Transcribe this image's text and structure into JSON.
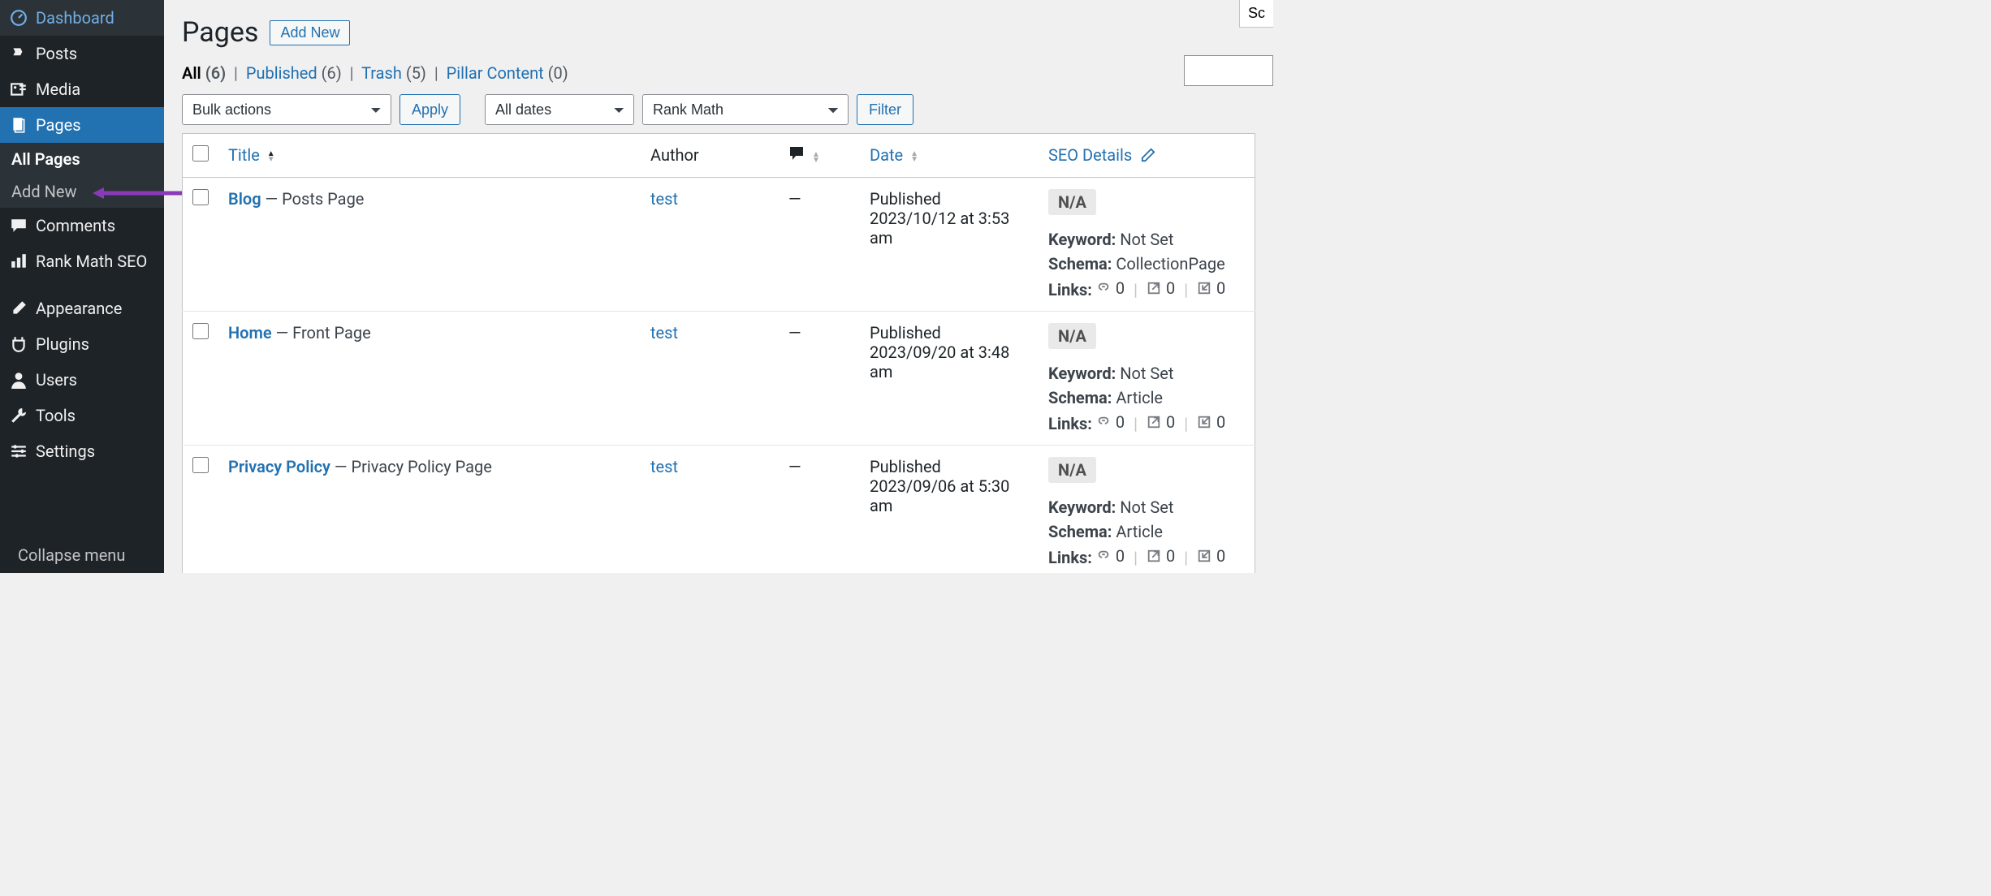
{
  "sidebar": {
    "items": [
      {
        "label": "Dashboard",
        "icon": "dashboard"
      },
      {
        "label": "Posts",
        "icon": "pin"
      },
      {
        "label": "Media",
        "icon": "media"
      },
      {
        "label": "Pages",
        "icon": "pages",
        "active": true
      },
      {
        "label": "Comments",
        "icon": "comment"
      },
      {
        "label": "Rank Math SEO",
        "icon": "chart"
      },
      {
        "label": "Appearance",
        "icon": "brush"
      },
      {
        "label": "Plugins",
        "icon": "plug"
      },
      {
        "label": "Users",
        "icon": "user"
      },
      {
        "label": "Tools",
        "icon": "wrench"
      },
      {
        "label": "Settings",
        "icon": "sliders"
      }
    ],
    "submenu": {
      "all_pages": "All Pages",
      "add_new": "Add New"
    },
    "collapse": "Collapse menu"
  },
  "header": {
    "title": "Pages",
    "add_new": "Add New",
    "screen_options": "Sc"
  },
  "filters": {
    "all_label": "All",
    "all_count": "(6)",
    "published_label": "Published",
    "published_count": "(6)",
    "trash_label": "Trash",
    "trash_count": "(5)",
    "pillar_label": "Pillar Content",
    "pillar_count": "(0)"
  },
  "controls": {
    "bulk_actions": "Bulk actions",
    "apply": "Apply",
    "all_dates": "All dates",
    "rank_math": "Rank Math",
    "filter": "Filter",
    "search_placeholder": ""
  },
  "columns": {
    "title": "Title",
    "author": "Author",
    "date": "Date",
    "seo": "SEO Details"
  },
  "rows": [
    {
      "title": "Blog",
      "subtitle": " — Posts Page",
      "author": "test",
      "comments": "—",
      "date_status": "Published",
      "date_value": "2023/10/12 at 3:53 am",
      "seo_badge": "N/A",
      "keyword": "Not Set",
      "schema": "CollectionPage",
      "links_internal": "0",
      "links_external": "0",
      "links_incoming": "0"
    },
    {
      "title": "Home",
      "subtitle": " — Front Page",
      "author": "test",
      "comments": "—",
      "date_status": "Published",
      "date_value": "2023/09/20 at 3:48 am",
      "seo_badge": "N/A",
      "keyword": "Not Set",
      "schema": "Article",
      "links_internal": "0",
      "links_external": "0",
      "links_incoming": "0"
    },
    {
      "title": "Privacy Policy",
      "subtitle": " — Privacy Policy Page",
      "author": "test",
      "comments": "—",
      "date_status": "Published",
      "date_value": "2023/09/06 at 5:30 am",
      "seo_badge": "N/A",
      "keyword": "Not Set",
      "schema": "Article",
      "links_internal": "0",
      "links_external": "0",
      "links_incoming": "0"
    }
  ],
  "labels": {
    "keyword": "Keyword:",
    "schema": "Schema:",
    "links": "Links:"
  }
}
